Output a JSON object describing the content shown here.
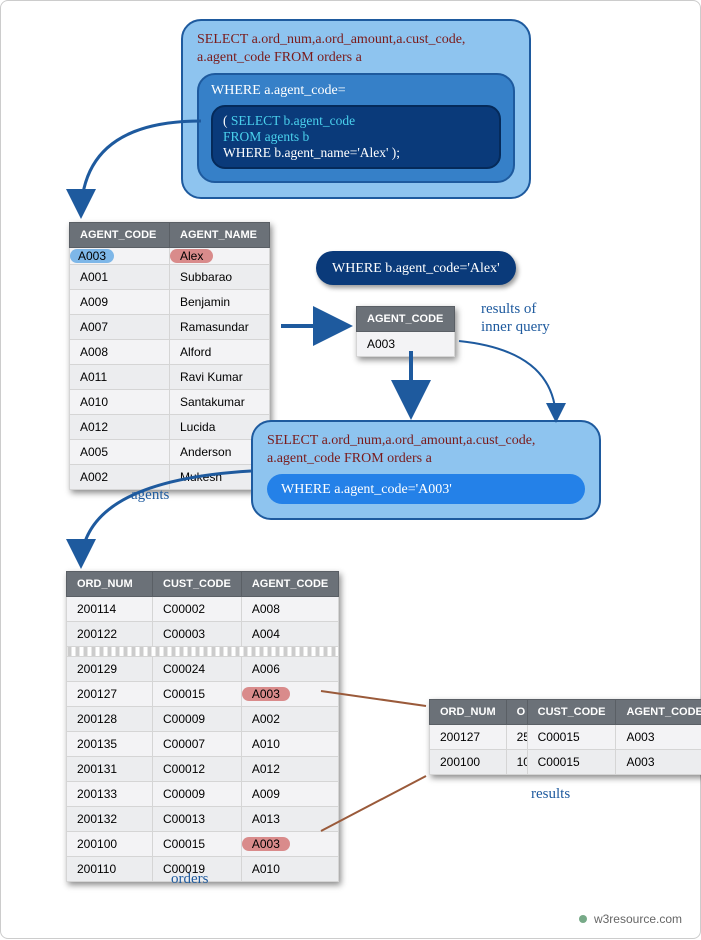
{
  "sql_outer1_line1": "SELECT a.ord_num,a.ord_amount,a.cust_code,",
  "sql_outer1_line2": "a.agent_code FROM orders a",
  "sql_mid1": "WHERE a.agent_code=",
  "sql_inner_l1a": "( ",
  "sql_inner_l1b": "SELECT b.agent_code",
  "sql_inner_l2": "FROM agents b",
  "sql_inner_l3": "WHERE b.agent_name='Alex' );",
  "pill_where_alex": "WHERE b.agent_code='Alex'",
  "sql_outer2_line1": "SELECT a.ord_num,a.ord_amount,a.cust_code,",
  "sql_outer2_line2": "a.agent_code FROM orders a",
  "sql_pill_blue": "WHERE a.agent_code='A003'",
  "agents_header": [
    "AGENT_CODE",
    "AGENT_NAME"
  ],
  "agents_rows": [
    [
      "A003",
      "Alex"
    ],
    [
      "A001",
      "Subbarao"
    ],
    [
      "A009",
      "Benjamin"
    ],
    [
      "A007",
      "Ramasundar"
    ],
    [
      "A008",
      "Alford"
    ],
    [
      "A011",
      "Ravi Kumar"
    ],
    [
      "A010",
      "Santakumar"
    ],
    [
      "A012",
      "Lucida"
    ],
    [
      "A005",
      "Anderson"
    ],
    [
      "A002",
      "Mukesh"
    ]
  ],
  "agentcode_header": [
    "AGENT_CODE"
  ],
  "agentcode_rows": [
    [
      "A003"
    ]
  ],
  "orders_header": [
    "ORD_NUM",
    "CUST_CODE",
    "AGENT_CODE"
  ],
  "orders_rows_top": [
    [
      "200114",
      "C00002",
      "A008"
    ],
    [
      "200122",
      "C00003",
      "A004"
    ]
  ],
  "orders_rows_bottom": [
    [
      "200129",
      "C00024",
      "A006"
    ],
    [
      "200127",
      "C00015",
      "A003"
    ],
    [
      "200128",
      "C00009",
      "A002"
    ],
    [
      "200135",
      "C00007",
      "A010"
    ],
    [
      "200131",
      "C00012",
      "A012"
    ],
    [
      "200133",
      "C00009",
      "A009"
    ],
    [
      "200132",
      "C00013",
      "A013"
    ],
    [
      "200100",
      "C00015",
      "A003"
    ],
    [
      "200110",
      "C00019",
      "A010"
    ]
  ],
  "results_header": [
    "ORD_NUM",
    "O",
    "CUST_CODE",
    "AGENT_CODE"
  ],
  "results_rows": [
    [
      "200127",
      "25",
      "C00015",
      "A003"
    ],
    [
      "200100",
      "10",
      "C00015",
      "A003"
    ]
  ],
  "label_agents": "agents",
  "label_inner1": "results of",
  "label_inner2": "inner query",
  "label_orders": "orders",
  "label_results": "results",
  "footer_text": "w3resource.com"
}
